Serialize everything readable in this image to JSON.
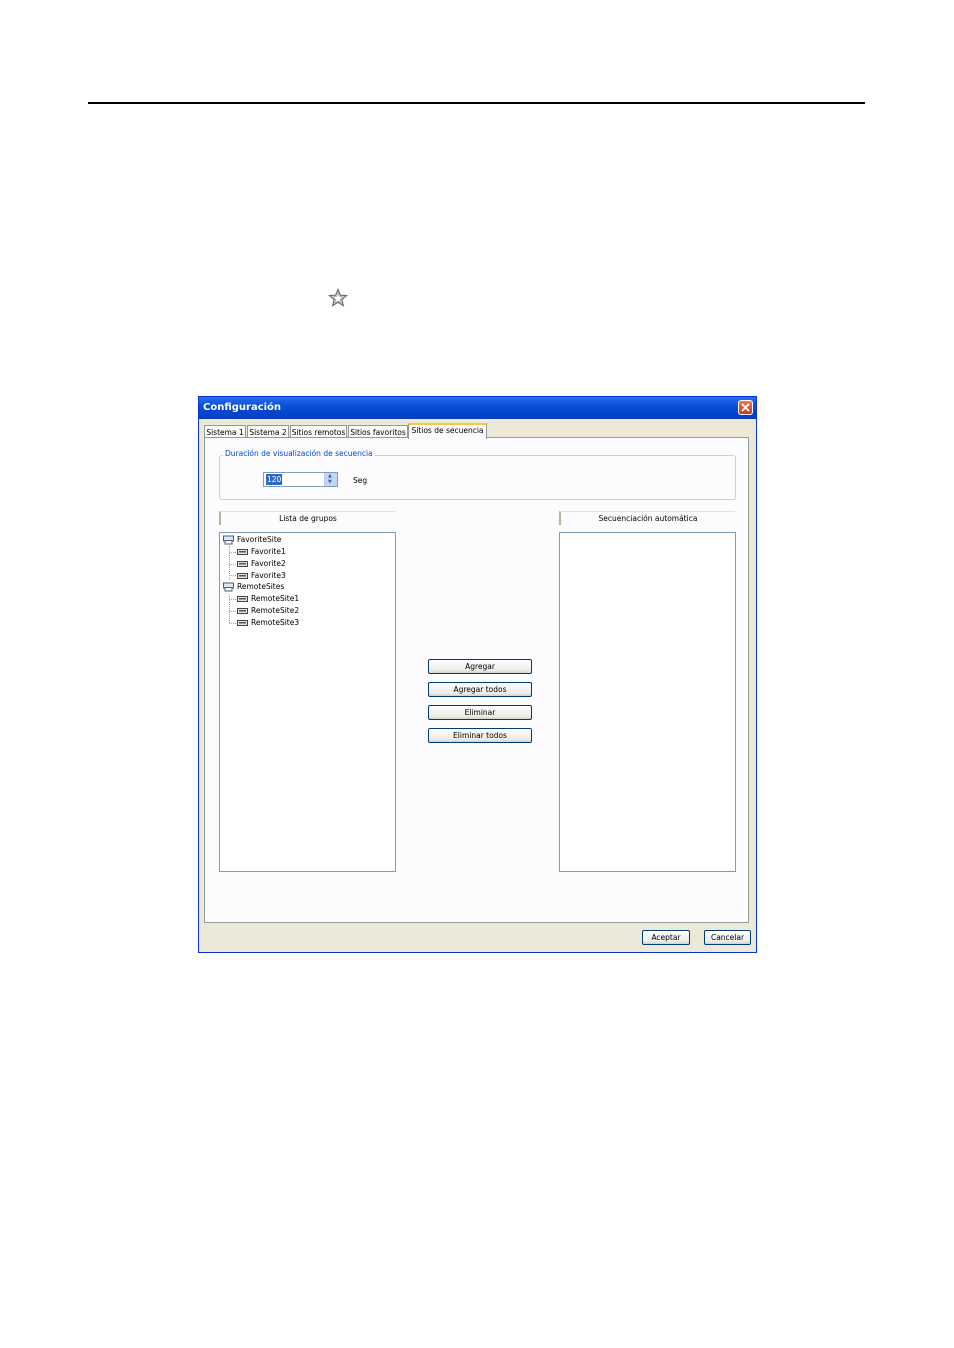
{
  "dialog": {
    "title": "Configuración",
    "tabs": [
      "Sistema 1",
      "Sistema 2",
      "Sitios remotos",
      "Sitios favoritos",
      "Sitios de secuencia"
    ],
    "active_tab": "Sitios de secuencia",
    "duration": {
      "label": "Duración de visualización de secuencia",
      "value": "120",
      "unit": "Seg"
    },
    "group_list": {
      "header": "Lista de grupos",
      "groups": [
        {
          "name": "FavoriteSite",
          "children": [
            "Favorite1",
            "Favorite2",
            "Favorite3"
          ]
        },
        {
          "name": "RemoteSites",
          "children": [
            "RemoteSite1",
            "RemoteSite2",
            "RemoteSite3"
          ]
        }
      ]
    },
    "auto_sequence": {
      "header": "Secuenciación automática",
      "items": []
    },
    "actions": {
      "add": "Agregar",
      "add_all": "Agregar todos",
      "remove": "Eliminar",
      "remove_all": "Eliminar todos"
    },
    "footer": {
      "ok": "Aceptar",
      "cancel": "Cancelar"
    }
  },
  "icons": {
    "favorite": "star-icon",
    "close": "close-icon",
    "group": "group-folder-icon",
    "site": "dvr-device-icon"
  }
}
